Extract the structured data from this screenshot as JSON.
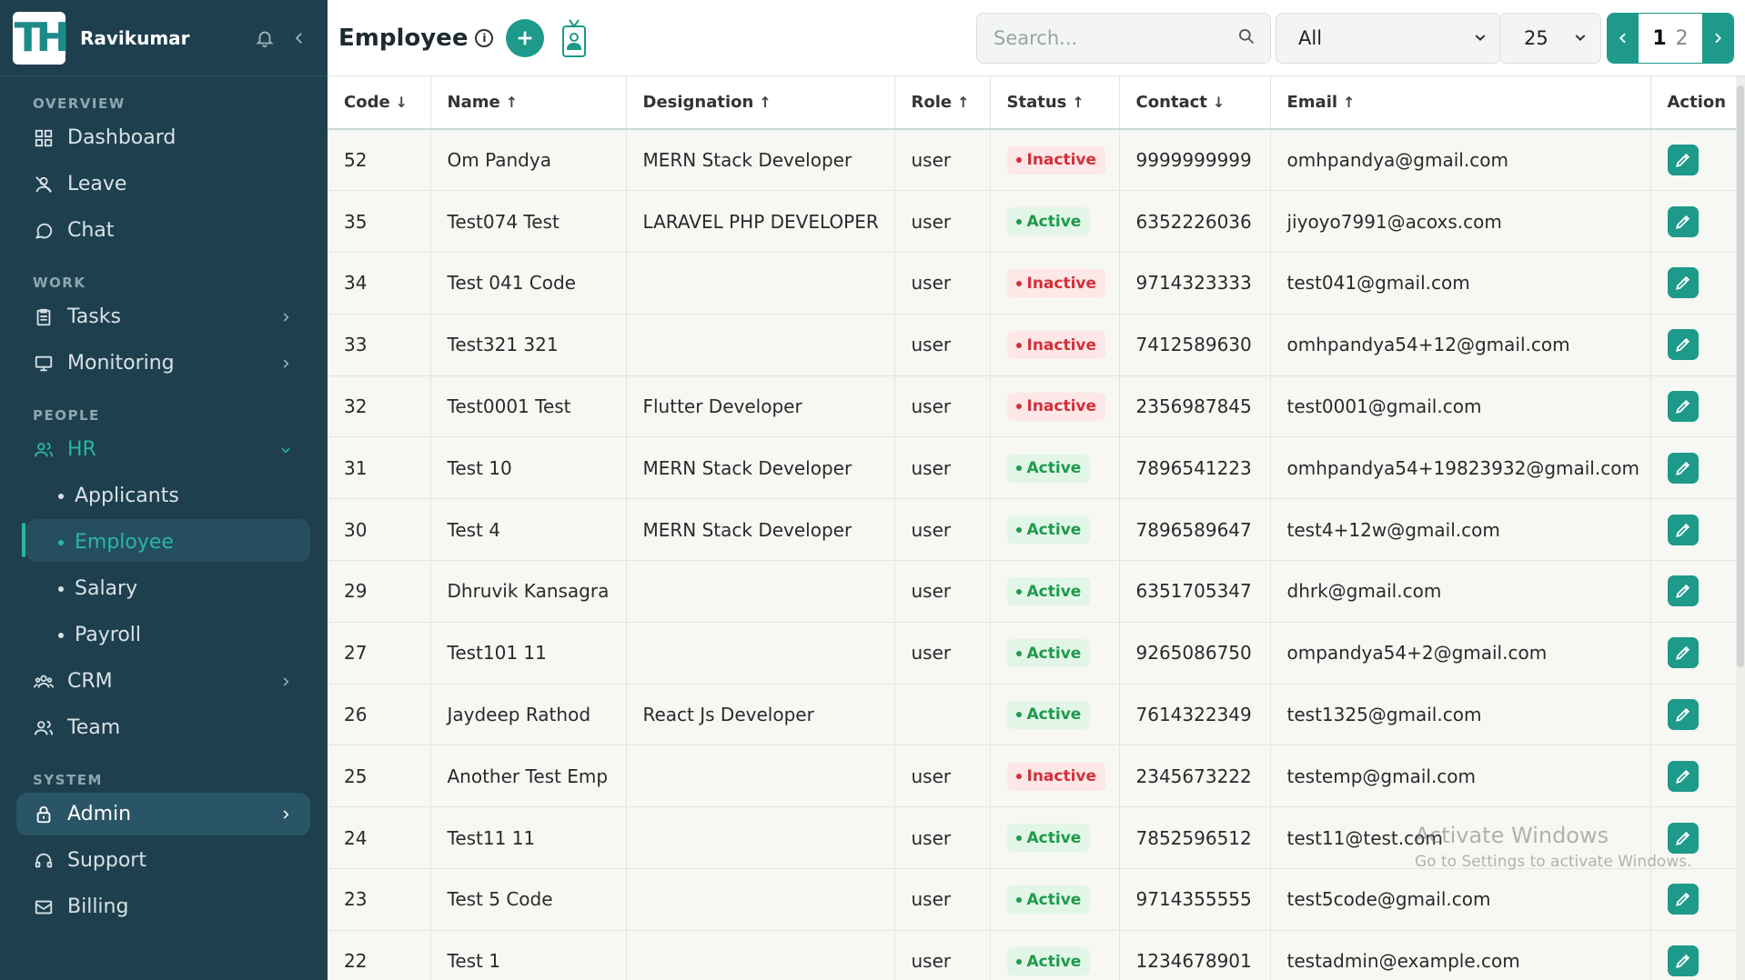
{
  "user": {
    "name": "Ravikumar",
    "logo_text": "TH"
  },
  "sidebar": {
    "sections": [
      {
        "label": "OVERVIEW",
        "items": [
          {
            "label": "Dashboard",
            "icon": "dashboard-icon"
          },
          {
            "label": "Leave",
            "icon": "leave-icon"
          },
          {
            "label": "Chat",
            "icon": "chat-icon"
          }
        ]
      },
      {
        "label": "WORK",
        "items": [
          {
            "label": "Tasks",
            "icon": "tasks-icon"
          },
          {
            "label": "Monitoring",
            "icon": "monitor-icon"
          }
        ]
      },
      {
        "label": "PEOPLE",
        "items": [
          {
            "label": "HR",
            "icon": "users-icon"
          },
          {
            "label": "Applicants"
          },
          {
            "label": "Employee"
          },
          {
            "label": "Salary"
          },
          {
            "label": "Payroll"
          },
          {
            "label": "CRM",
            "icon": "crm-icon"
          },
          {
            "label": "Team",
            "icon": "team-icon"
          }
        ]
      },
      {
        "label": "SYSTEM",
        "items": [
          {
            "label": "Admin",
            "icon": "lock-icon"
          },
          {
            "label": "Support",
            "icon": "support-icon"
          },
          {
            "label": "Billing",
            "icon": "billing-icon"
          }
        ]
      }
    ]
  },
  "header": {
    "title": "Employee",
    "search_placeholder": "Search...",
    "filter_value": "All",
    "page_size": "25",
    "current_page": "1",
    "next_page": "2"
  },
  "table": {
    "columns": [
      "Code",
      "Name",
      "Designation",
      "Role",
      "Status",
      "Contact",
      "Email",
      "Action"
    ],
    "sort_arrows": [
      "↓",
      "↑",
      "↑",
      "↑",
      "↑",
      "↓",
      "↑",
      ""
    ],
    "rows": [
      {
        "code": "52",
        "name": "Om Pandya",
        "designation": "MERN Stack Developer",
        "role": "user",
        "status": "Inactive",
        "contact": "9999999999",
        "email": "omhpandya@gmail.com"
      },
      {
        "code": "35",
        "name": "Test074 Test",
        "designation": "LARAVEL PHP DEVELOPER",
        "role": "user",
        "status": "Active",
        "contact": "6352226036",
        "email": "jiyoyo7991@acoxs.com"
      },
      {
        "code": "34",
        "name": "Test 041 Code",
        "designation": "",
        "role": "user",
        "status": "Inactive",
        "contact": "9714323333",
        "email": "test041@gmail.com"
      },
      {
        "code": "33",
        "name": "Test321 321",
        "designation": "",
        "role": "user",
        "status": "Inactive",
        "contact": "7412589630",
        "email": "omhpandya54+12@gmail.com"
      },
      {
        "code": "32",
        "name": "Test0001 Test",
        "designation": "Flutter Developer",
        "role": "user",
        "status": "Inactive",
        "contact": "2356987845",
        "email": "test0001@gmail.com"
      },
      {
        "code": "31",
        "name": "Test 10",
        "designation": "MERN Stack Developer",
        "role": "user",
        "status": "Active",
        "contact": "7896541223",
        "email": "omhpandya54+19823932@gmail.com"
      },
      {
        "code": "30",
        "name": "Test 4",
        "designation": "MERN Stack Developer",
        "role": "user",
        "status": "Active",
        "contact": "7896589647",
        "email": "test4+12w@gmail.com"
      },
      {
        "code": "29",
        "name": "Dhruvik Kansagra",
        "designation": "",
        "role": "user",
        "status": "Active",
        "contact": "6351705347",
        "email": "dhrk@gmail.com"
      },
      {
        "code": "27",
        "name": "Test101 11",
        "designation": "",
        "role": "user",
        "status": "Active",
        "contact": "9265086750",
        "email": "ompandya54+2@gmail.com"
      },
      {
        "code": "26",
        "name": "Jaydeep Rathod",
        "designation": "React Js Developer",
        "role": "",
        "status": "Active",
        "contact": "7614322349",
        "email": "test1325@gmail.com"
      },
      {
        "code": "25",
        "name": "Another Test Emp",
        "designation": "",
        "role": "user",
        "status": "Inactive",
        "contact": "2345673222",
        "email": "testemp@gmail.com"
      },
      {
        "code": "24",
        "name": "Test11 11",
        "designation": "",
        "role": "user",
        "status": "Active",
        "contact": "7852596512",
        "email": "test11@test.com"
      },
      {
        "code": "23",
        "name": "Test 5 Code",
        "designation": "",
        "role": "user",
        "status": "Active",
        "contact": "9714355555",
        "email": "test5code@gmail.com"
      },
      {
        "code": "22",
        "name": "Test 1",
        "designation": "",
        "role": "user",
        "status": "Active",
        "contact": "1234678901",
        "email": "testadmin@example.com"
      }
    ]
  },
  "watermark": {
    "line1": "Activate Windows",
    "line2": "Go to Settings to activate Windows."
  },
  "colors": {
    "sidebar_bg": "#1e3f4e",
    "accent": "#1d9a8a",
    "active_green": "#1f9a4c",
    "inactive_red": "#d2303a"
  }
}
